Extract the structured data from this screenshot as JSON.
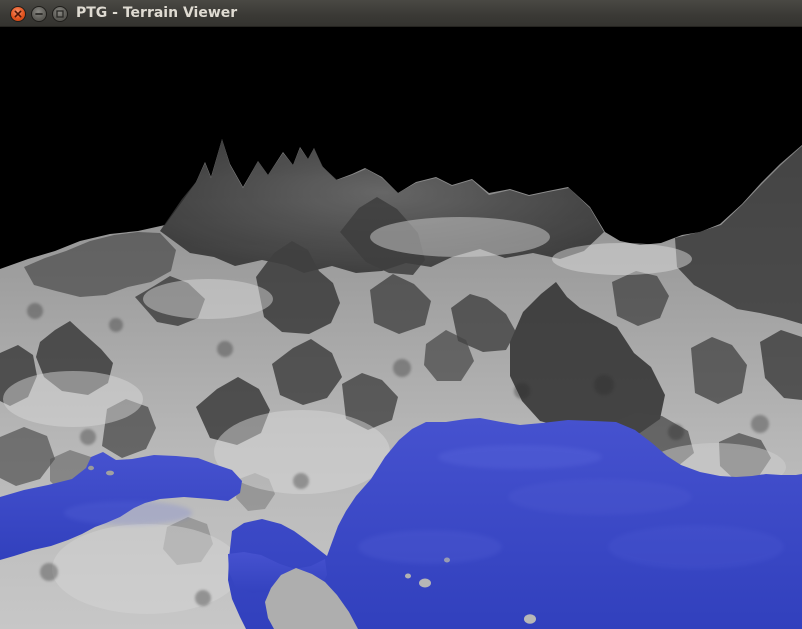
{
  "window": {
    "title": "PTG - Terrain Viewer"
  },
  "titlebar": {
    "controls": [
      {
        "name": "close",
        "icon": "close-icon",
        "color": "#e2531e"
      },
      {
        "name": "minimize",
        "icon": "minimize-icon",
        "color": "#5d5c57"
      },
      {
        "name": "maximize",
        "icon": "maximize-icon",
        "color": "#5d5c57"
      }
    ]
  },
  "viewer": {
    "sky_color": "#000000",
    "terrain_color": "#b9b9b9",
    "shadow_color": "#3a3a3a",
    "water_color": "#3d47c7"
  }
}
